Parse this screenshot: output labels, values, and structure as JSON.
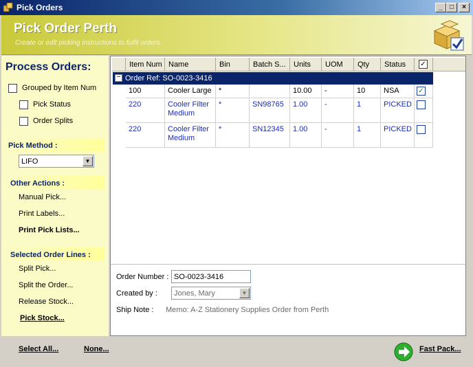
{
  "window": {
    "title": "Pick Orders",
    "min_glyph": "_",
    "max_glyph": "□",
    "close_glyph": "×"
  },
  "banner": {
    "title": "Pick Order Perth",
    "subtitle": "Create or edit picking instructions to fulfil orders."
  },
  "sidebar": {
    "heading": "Process Orders:",
    "options": {
      "grouped_label": "Grouped by Item Num",
      "pick_status_label": "Pick Status",
      "order_splits_label": "Order Splits"
    },
    "pick_method": {
      "label": "Pick Method :",
      "selected": "LIFO"
    },
    "other_actions": {
      "label": "Other Actions :",
      "items": [
        "Manual Pick...",
        "Print Labels...",
        "Print Pick Lists..."
      ]
    },
    "selected_lines": {
      "label": "Selected Order Lines :",
      "items": [
        "Split Pick...",
        "Split the Order...",
        "Release Stock...",
        "Pick Stock..."
      ]
    }
  },
  "grid": {
    "columns": [
      "Item Num",
      "Name",
      "Bin",
      "Batch S...",
      "Units",
      "UOM",
      "Qty",
      "Status"
    ],
    "group_label": "Order Ref: SO-0023-3416",
    "rows": [
      {
        "item": "100",
        "name": "Cooler Large",
        "bin": "*",
        "batch": "",
        "units": "10.00",
        "uom": "-",
        "qty": "10",
        "status": "NSA",
        "checked": true
      },
      {
        "item": "220",
        "name": "Cooler Filter Medium",
        "bin": "*",
        "batch": "SN98765",
        "units": "1.00",
        "uom": "-",
        "qty": "1",
        "status": "PICKED",
        "checked": false
      },
      {
        "item": "220",
        "name": "Cooler Filter Medium",
        "bin": "*",
        "batch": "SN12345",
        "units": "1.00",
        "uom": "-",
        "qty": "1",
        "status": "PICKED",
        "checked": false
      }
    ]
  },
  "form": {
    "order_number_label": "Order Number :",
    "order_number_value": "SO-0023-3416",
    "created_by_label": "Created by :",
    "created_by_value": "Jones, Mary",
    "ship_note_label": "Ship Note :",
    "ship_note_value": "Memo: A-Z Stationery Supplies Order from Perth"
  },
  "footer": {
    "select_all": "Select All...",
    "none": "None...",
    "fast_pack": "Fast Pack..."
  },
  "icons": [
    "app-icon",
    "boxes-check-icon",
    "go-arrow-icon",
    "checkmark-icon",
    "collapse-icon",
    "dropdown-arrow-icon"
  ],
  "colors": {
    "banner": "#c9c93a",
    "sidebar": "#fbfbc8",
    "accent": "#0a246a",
    "link_blue": "#1c2db5"
  }
}
